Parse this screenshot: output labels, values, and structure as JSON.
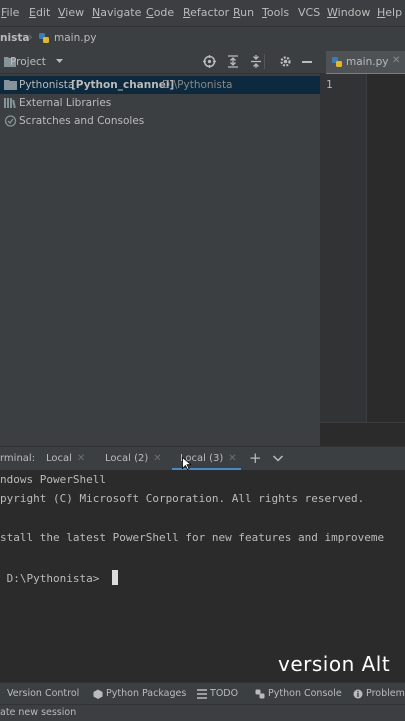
{
  "menu": {
    "items": [
      {
        "label": "File",
        "u": "F",
        "rest": "ile"
      },
      {
        "label": "Edit",
        "u": "E",
        "rest": "dit"
      },
      {
        "label": "View",
        "u": "V",
        "rest": "iew"
      },
      {
        "label": "Navigate",
        "u": "N",
        "rest": "avigate"
      },
      {
        "label": "Code",
        "u": "C",
        "rest": "ode"
      },
      {
        "label": "Refactor",
        "u": "R",
        "rest": "efactor"
      },
      {
        "label": "Run",
        "u": "R",
        "rest": "un"
      },
      {
        "label": "Tools",
        "u": "T",
        "rest": "ools"
      },
      {
        "label": "VCS",
        "u": "",
        "rest": "VCS"
      },
      {
        "label": "Window",
        "u": "W",
        "rest": "indow"
      },
      {
        "label": "Help",
        "u": "H",
        "rest": "elp"
      }
    ]
  },
  "breadcrumb": {
    "project": "nista",
    "file": "main.py"
  },
  "project_panel": {
    "title": "Project",
    "tree": [
      {
        "name": "Pythonista",
        "bold": "[Python_channel]",
        "path": "D:\\Pythonista",
        "selected": true
      },
      {
        "name": "External Libraries"
      },
      {
        "name": "Scratches and Consoles"
      }
    ]
  },
  "editor": {
    "tab_label": "main.py",
    "line_numbers": [
      "1"
    ]
  },
  "terminal": {
    "label": "rminal:",
    "tabs": [
      "Local",
      "Local (2)",
      "Local (3)"
    ],
    "active_tab": 2,
    "lines": [
      "ndows PowerShell",
      "pyright (C) Microsoft Corporation. All rights reserved.",
      "",
      "stall the latest PowerShell for new features and improveme",
      "",
      " D:\\Pythonista> "
    ]
  },
  "watermark": "version Alt",
  "tool_strip": {
    "items": [
      "Version Control",
      "Python Packages",
      "TODO",
      "Python Console",
      "Problems"
    ]
  },
  "status": {
    "text": "ate new session"
  },
  "colors": {
    "accent": "#4a88c7",
    "folder": "#87939a",
    "selection": "#0d293e"
  }
}
